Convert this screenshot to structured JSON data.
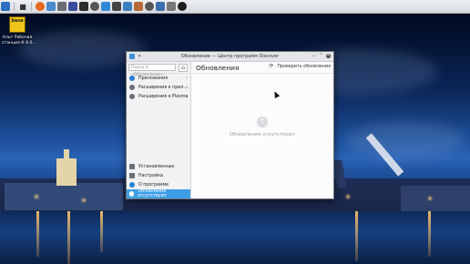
{
  "desktop": {
    "icon": {
      "badge": "basa",
      "label_line1": "Альт Рабочая",
      "label_line2": "станция К 9.0..."
    }
  },
  "taskbar": {
    "icons": [
      "app-menu-icon",
      "firefox-icon",
      "file-manager-icon",
      "folder-icon",
      "terminal-icon",
      "office-icon",
      "settings-icon",
      "media-icon",
      "text-icon",
      "image-icon",
      "software-icon",
      "headphones-icon",
      "monitor-icon",
      "network-icon",
      "power-icon"
    ]
  },
  "window": {
    "title": "Обновление — Центр программ Discover",
    "controls": {
      "minimize": "⌄",
      "maximize": "⌃",
      "close": "✕"
    },
    "sidebar": {
      "search_placeholder": "Поиск в «Обновление»...",
      "home_icon": "⌂",
      "categories": [
        {
          "label": "Приложения",
          "arrow": "›",
          "color": "#2b7fd4"
        },
        {
          "label": "Расширения к прил...",
          "arrow": "›",
          "color": "#6b6f75"
        },
        {
          "label": "Расширения к Plasma",
          "arrow": "›",
          "color": "#6b6f75"
        }
      ],
      "bottom": [
        {
          "label": "Установленные",
          "color": "#6b6f75"
        },
        {
          "label": "Настройка",
          "color": "#6b6f75"
        },
        {
          "label": "О программе",
          "color": "#2b7fd4"
        },
        {
          "label": "Обновления отсутствуют",
          "color": "#ffffff"
        }
      ]
    },
    "main": {
      "title": "Обновления",
      "check_button": "Проверить обновления",
      "empty_text": "Обновления отсутствуют"
    }
  }
}
